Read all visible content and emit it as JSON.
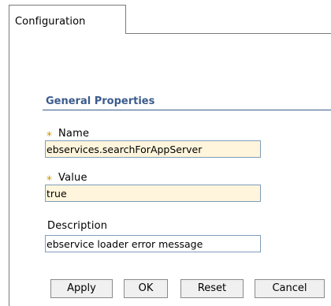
{
  "tabs": [
    {
      "label": "Configuration",
      "selected": true
    }
  ],
  "section": {
    "title": "General Properties"
  },
  "fields": {
    "name": {
      "label": "Name",
      "value": "ebservices.searchForAppServer",
      "required": true
    },
    "value": {
      "label": "Value",
      "value": "true",
      "required": true
    },
    "description": {
      "label": "Description",
      "value": "ebservice loader error message",
      "required": false
    }
  },
  "required_marker": "*",
  "buttons": {
    "apply": "Apply",
    "ok": "OK",
    "reset": "Reset",
    "cancel": "Cancel"
  },
  "colors": {
    "section_title": "#3b5b8c",
    "required_marker": "#cc9900",
    "required_field_bg": "#fff5dc",
    "field_border": "#7f9db9"
  }
}
